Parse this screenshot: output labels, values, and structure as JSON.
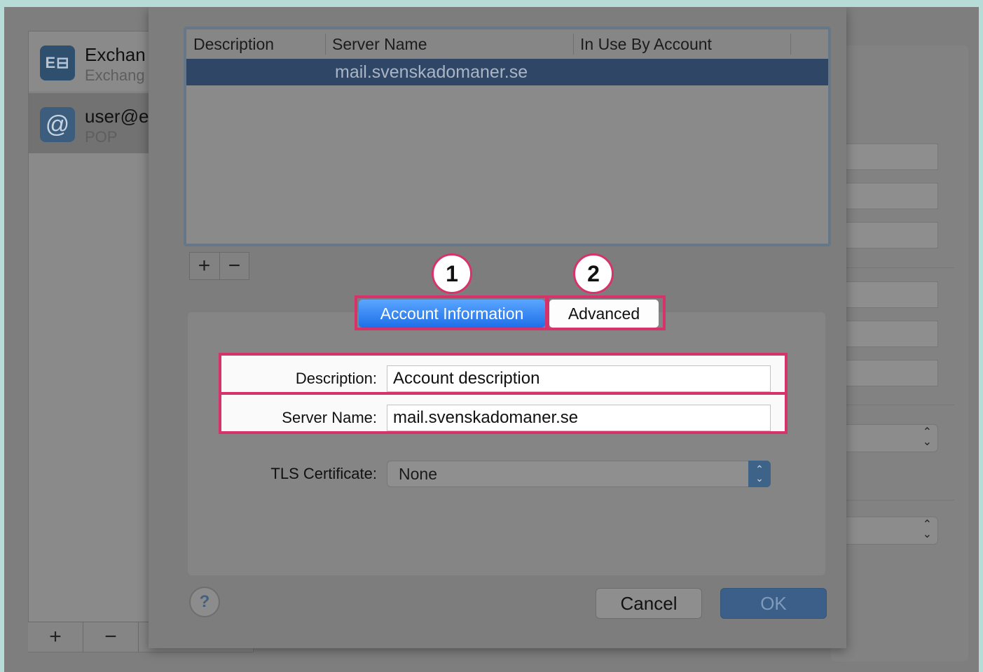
{
  "accounts": [
    {
      "name": "Exchan",
      "type": "Exchang",
      "icon": "exchange-icon"
    },
    {
      "name": "user@e",
      "type": "POP",
      "icon": "at-sign-icon"
    }
  ],
  "account_list_controls": {
    "add": "+",
    "remove": "−"
  },
  "server_table": {
    "columns": [
      "Description",
      "Server Name",
      "In Use By Account"
    ],
    "rows": [
      {
        "description": "",
        "server_name": "mail.svenskadomaner.se",
        "in_use_by": ""
      }
    ]
  },
  "table_controls": {
    "add": "+",
    "remove": "−"
  },
  "callouts": [
    "1",
    "2"
  ],
  "tabs": {
    "account_information": "Account Information",
    "advanced": "Advanced"
  },
  "form": {
    "description_label": "Description:",
    "description_value": "Account description",
    "server_name_label": "Server Name:",
    "server_name_value": "mail.svenskadomaner.se",
    "tls_label": "TLS Certificate:",
    "tls_value": "None"
  },
  "footer": {
    "help": "?",
    "cancel": "Cancel",
    "ok": "OK"
  },
  "colors": {
    "highlight": "#d6336c",
    "active_tab": "#1e6fe8",
    "selection": "#2f4666"
  }
}
